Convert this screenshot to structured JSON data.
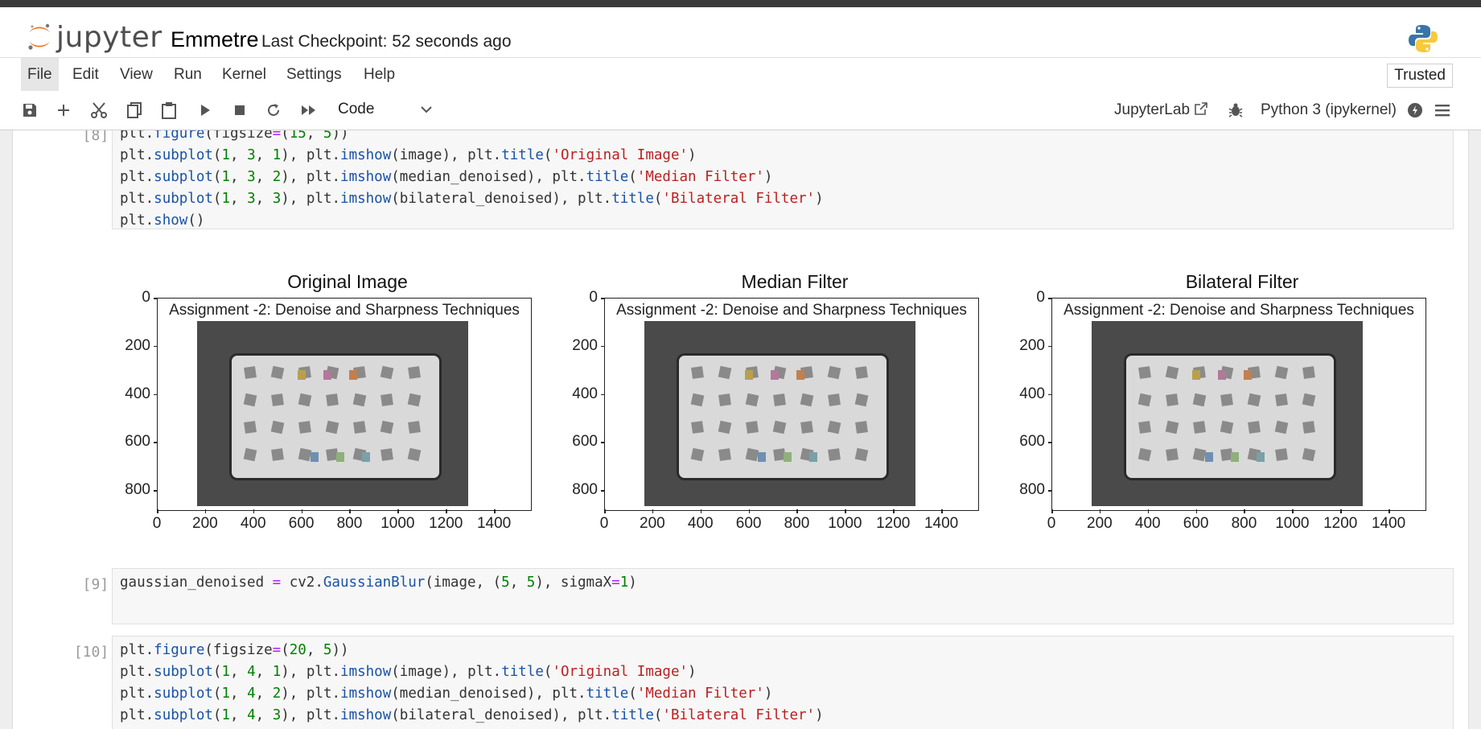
{
  "app": {
    "logo_text": "jupyter",
    "notebook_name": "Emmetre",
    "checkpoint": "Last Checkpoint: 52 seconds ago"
  },
  "menu": {
    "items": [
      "File",
      "Edit",
      "View",
      "Run",
      "Kernel",
      "Settings",
      "Help"
    ],
    "trusted": "Trusted"
  },
  "toolbar": {
    "icons": [
      "save-icon",
      "add-cell-icon",
      "cut-icon",
      "copy-icon",
      "paste-icon",
      "run-icon",
      "stop-icon",
      "restart-icon",
      "fast-forward-icon"
    ],
    "cell_type": "Code",
    "jupyterlab_link": "JupyterLab",
    "kernel_name": "Python 3 (ipykernel)"
  },
  "cells": [
    {
      "prompt": "[8]:",
      "lines": [
        "plt.figure(figsize=(15, 5))",
        "plt.subplot(1, 3, 1), plt.imshow(image), plt.title('Original Image')",
        "plt.subplot(1, 3, 2), plt.imshow(median_denoised), plt.title('Median Filter')",
        "plt.subplot(1, 3, 3), plt.imshow(bilateral_denoised), plt.title('Bilateral Filter')",
        "plt.show()"
      ]
    },
    {
      "prompt": "[9]:",
      "lines": [
        "gaussian_denoised = cv2.GaussianBlur(image, (5, 5), sigmaX=1)"
      ]
    },
    {
      "prompt": "[10]:",
      "lines": [
        "plt.figure(figsize=(20, 5))",
        "plt.subplot(1, 4, 1), plt.imshow(image), plt.title('Original Image')",
        "plt.subplot(1, 4, 2), plt.imshow(median_denoised), plt.title('Median Filter')",
        "plt.subplot(1, 4, 3), plt.imshow(bilateral_denoised), plt.title('Bilateral Filter')"
      ]
    }
  ],
  "output": {
    "subplots": [
      {
        "title": "Original Image",
        "caption": "Assignment -2: Denoise and Sharpness Techniques"
      },
      {
        "title": "Median Filter",
        "caption": "Assignment -2: Denoise and Sharpness Techniques"
      },
      {
        "title": "Bilateral Filter",
        "caption": "Assignment -2: Denoise and Sharpness Techniques"
      }
    ],
    "y_ticks": [
      "0",
      "200",
      "400",
      "600",
      "800"
    ],
    "x_ticks": [
      "0",
      "200",
      "400",
      "600",
      "800",
      "1000",
      "1200",
      "1400"
    ]
  }
}
